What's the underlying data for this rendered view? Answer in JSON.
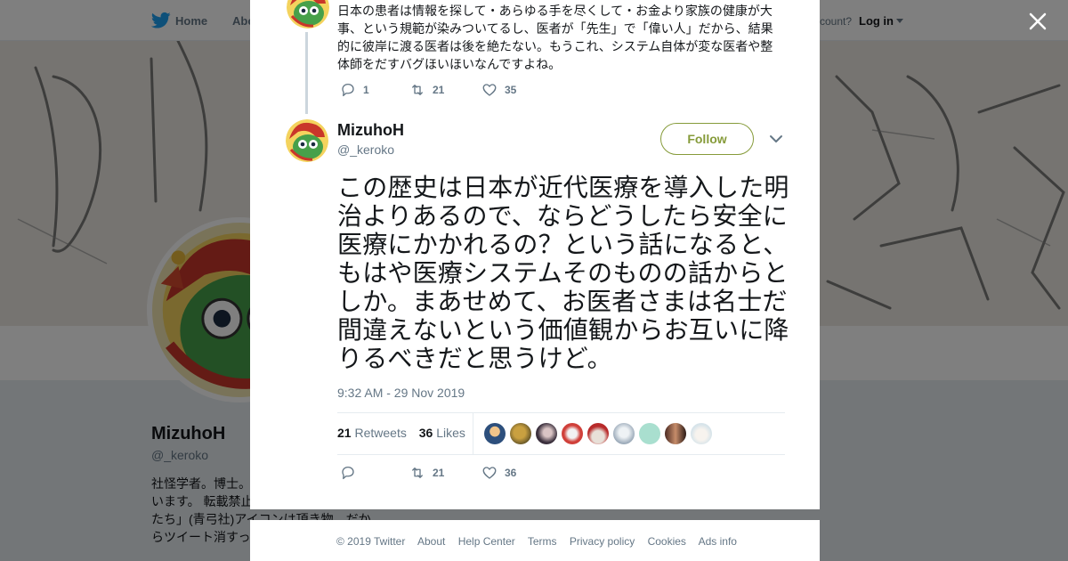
{
  "nav": {
    "home": "Home",
    "about": "Abo",
    "account_prompt": "ccount?",
    "login": "Log in"
  },
  "profile": {
    "name": "MizuhoH",
    "handle": "@_keroko",
    "bio": "社怪学者。博士。\nいます。 転載禁止\nたち」(青弓社)アイコンは頂き物。だか\nらツイート消すっ"
  },
  "previous_tweet": {
    "text": "日本の患者は情報を探して・あらゆる手を尽くして・お金より家族の健康が大事、という規範が染みついてるし、医者が「先生」で「偉い人」だから、結果的に彼岸に渡る医者は後を絶たない。もうこれ、システム自体が変な医者や整体師をだすバグほいほいなんですよね。",
    "replies": "1",
    "retweets": "21",
    "likes": "35"
  },
  "tweet": {
    "author_name": "MizuhoH",
    "author_handle": "@_keroko",
    "follow_label": "Follow",
    "text": "この歴史は日本が近代医療を導入した明治よりあるので、ならどうしたら安全に医療にかかれるの？という話になると、もはや医療システムそのものの話からとしか。まあせめて、お医者さまは名士だ間違えないという価値観からお互いに降りるべきだと思うけど。",
    "timestamp": "9:32 AM - 29 Nov 2019",
    "retweet_count": "21",
    "retweet_label": "Retweets",
    "like_count": "36",
    "like_label": "Likes",
    "retweets_action": "21",
    "likes_action": "36"
  },
  "footer": {
    "links": [
      "© 2019 Twitter",
      "About",
      "Help Center",
      "Terms",
      "Privacy policy",
      "Cookies",
      "Ads info"
    ]
  },
  "colors": {
    "follow_accent": "#869b3a",
    "text_secondary": "#657786",
    "twitter_blue": "#1da1f2"
  },
  "icons": [
    "twitter-bird-icon",
    "close-icon",
    "reply-icon",
    "retweet-icon",
    "heart-icon",
    "chevron-down-icon"
  ]
}
